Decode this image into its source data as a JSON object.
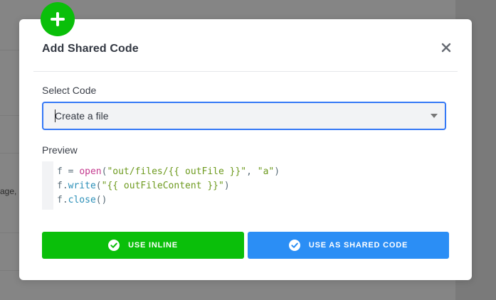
{
  "background": {
    "partial_text": "age,"
  },
  "modal": {
    "title": "Add Shared Code",
    "badge_icon": "plus-icon",
    "close_icon": "close-icon",
    "colors": {
      "accent_green": "#0abf0a",
      "accent_blue": "#2b8ef5",
      "focus_border": "#3478f6"
    }
  },
  "select_code": {
    "label": "Select Code",
    "value": "Create a file",
    "arrow_icon": "chevron-down-icon"
  },
  "preview": {
    "label": "Preview",
    "lines": [
      [
        {
          "text": "f",
          "kind": "var"
        },
        {
          "text": " = ",
          "kind": "op"
        },
        {
          "text": "open",
          "kind": "fn"
        },
        {
          "text": "(",
          "kind": "punc"
        },
        {
          "text": "\"out/files/{{ outFile }}\"",
          "kind": "str"
        },
        {
          "text": ", ",
          "kind": "punc"
        },
        {
          "text": "\"a\"",
          "kind": "str"
        },
        {
          "text": ")",
          "kind": "punc"
        }
      ],
      [
        {
          "text": "f.",
          "kind": "var"
        },
        {
          "text": "write",
          "kind": "meth"
        },
        {
          "text": "(",
          "kind": "punc"
        },
        {
          "text": "\"{{ outFileContent }}\"",
          "kind": "str"
        },
        {
          "text": ")",
          "kind": "punc"
        }
      ],
      [
        {
          "text": "f.",
          "kind": "var"
        },
        {
          "text": "close",
          "kind": "meth"
        },
        {
          "text": "()",
          "kind": "punc"
        }
      ]
    ]
  },
  "buttons": {
    "use_inline": "USE INLINE",
    "use_shared": "USE AS SHARED CODE",
    "icon": "check-circle-icon"
  }
}
